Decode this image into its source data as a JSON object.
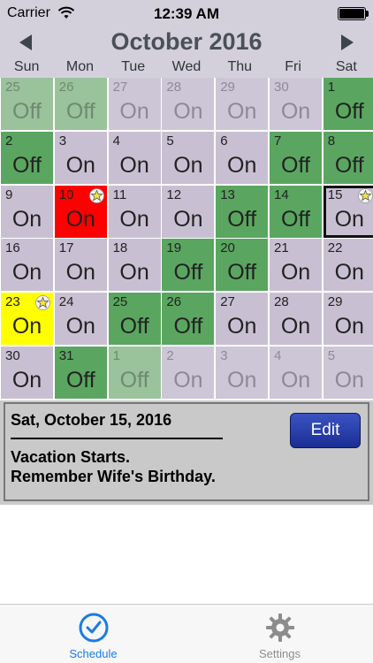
{
  "status_bar": {
    "carrier": "Carrier",
    "time": "12:39 AM"
  },
  "header": {
    "title": "October 2016",
    "prev_icon": "triangle-left",
    "next_icon": "triangle-right"
  },
  "weekdays": [
    "Sun",
    "Mon",
    "Tue",
    "Wed",
    "Thu",
    "Fri",
    "Sat"
  ],
  "calendar": {
    "rows": [
      [
        {
          "day": "25",
          "status": "Off",
          "style": "dimoff"
        },
        {
          "day": "26",
          "status": "Off",
          "style": "dimoff"
        },
        {
          "day": "27",
          "status": "On",
          "style": "dimon"
        },
        {
          "day": "28",
          "status": "On",
          "style": "dimon"
        },
        {
          "day": "29",
          "status": "On",
          "style": "dimon"
        },
        {
          "day": "30",
          "status": "On",
          "style": "dimon"
        },
        {
          "day": "1",
          "status": "Off",
          "style": "off"
        }
      ],
      [
        {
          "day": "2",
          "status": "Off",
          "style": "off"
        },
        {
          "day": "3",
          "status": "On",
          "style": "on"
        },
        {
          "day": "4",
          "status": "On",
          "style": "on"
        },
        {
          "day": "5",
          "status": "On",
          "style": "on"
        },
        {
          "day": "6",
          "status": "On",
          "style": "on"
        },
        {
          "day": "7",
          "status": "Off",
          "style": "off"
        },
        {
          "day": "8",
          "status": "Off",
          "style": "off"
        }
      ],
      [
        {
          "day": "9",
          "status": "On",
          "style": "on"
        },
        {
          "day": "10",
          "status": "On",
          "style": "red",
          "star": true
        },
        {
          "day": "11",
          "status": "On",
          "style": "on"
        },
        {
          "day": "12",
          "status": "On",
          "style": "on"
        },
        {
          "day": "13",
          "status": "Off",
          "style": "off"
        },
        {
          "day": "14",
          "status": "Off",
          "style": "off"
        },
        {
          "day": "15",
          "status": "On",
          "style": "on",
          "star": true,
          "selected": true
        }
      ],
      [
        {
          "day": "16",
          "status": "On",
          "style": "on"
        },
        {
          "day": "17",
          "status": "On",
          "style": "on"
        },
        {
          "day": "18",
          "status": "On",
          "style": "on"
        },
        {
          "day": "19",
          "status": "Off",
          "style": "off"
        },
        {
          "day": "20",
          "status": "Off",
          "style": "off"
        },
        {
          "day": "21",
          "status": "On",
          "style": "on"
        },
        {
          "day": "22",
          "status": "On",
          "style": "on"
        }
      ],
      [
        {
          "day": "23",
          "status": "On",
          "style": "yellow",
          "star": true
        },
        {
          "day": "24",
          "status": "On",
          "style": "on"
        },
        {
          "day": "25",
          "status": "Off",
          "style": "off"
        },
        {
          "day": "26",
          "status": "Off",
          "style": "off"
        },
        {
          "day": "27",
          "status": "On",
          "style": "on"
        },
        {
          "day": "28",
          "status": "On",
          "style": "on"
        },
        {
          "day": "29",
          "status": "On",
          "style": "on"
        }
      ],
      [
        {
          "day": "30",
          "status": "On",
          "style": "on"
        },
        {
          "day": "31",
          "status": "Off",
          "style": "off"
        },
        {
          "day": "1",
          "status": "Off",
          "style": "dimoff"
        },
        {
          "day": "2",
          "status": "On",
          "style": "dimon"
        },
        {
          "day": "3",
          "status": "On",
          "style": "dimon"
        },
        {
          "day": "4",
          "status": "On",
          "style": "dimon"
        },
        {
          "day": "5",
          "status": "On",
          "style": "dimon"
        }
      ]
    ]
  },
  "detail": {
    "date": "Sat, October 15, 2016",
    "note_line1": "Vacation Starts.",
    "note_line2": "Remember Wife's Birthday.",
    "edit_label": "Edit"
  },
  "tabbar": {
    "schedule_label": "Schedule",
    "settings_label": "Settings",
    "schedule_icon": "checkmark-circle-icon",
    "settings_icon": "gear-icon"
  },
  "colors": {
    "on": "#c8c0d2",
    "off": "#5aa660",
    "highlight_red": "#ff0000",
    "highlight_yellow": "#ffff00",
    "accent": "#1a7be5",
    "edit_button": "#2a41b0"
  }
}
